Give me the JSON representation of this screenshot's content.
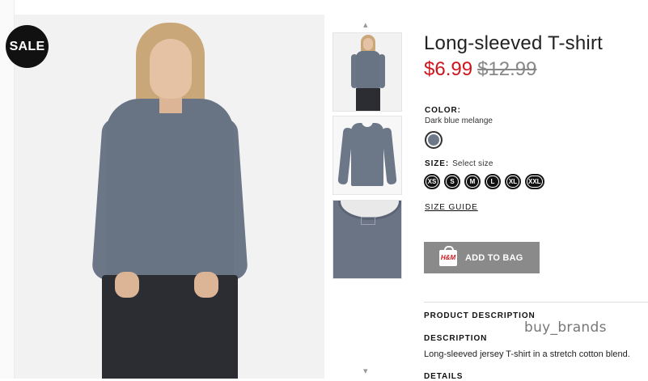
{
  "badge": {
    "sale": "SALE"
  },
  "thumbnails": {
    "up_arrow": "▴",
    "down_arrow": "▾"
  },
  "product": {
    "title": "Long-sleeved T-shirt",
    "price_sale": "$6.99",
    "price_original": "$12.99"
  },
  "color": {
    "label": "COLOR:",
    "value": "Dark blue melange",
    "swatch_color": "#6e7889"
  },
  "size": {
    "label": "SIZE:",
    "hint": "Select size",
    "options": [
      "XS",
      "S",
      "M",
      "L",
      "XL",
      "XXL"
    ],
    "guide": "SIZE GUIDE"
  },
  "cart": {
    "add_label": "ADD TO BAG",
    "bag_logo": "H&M"
  },
  "description": {
    "section_title": "PRODUCT DESCRIPTION",
    "heading": "DESCRIPTION",
    "text": "Long-sleeved jersey T-shirt in a stretch cotton blend.",
    "details_heading": "DETAILS"
  },
  "watermark": "buy_brands",
  "colors": {
    "sale_price": "#d1141b",
    "button_bg": "#8a8a8a"
  }
}
